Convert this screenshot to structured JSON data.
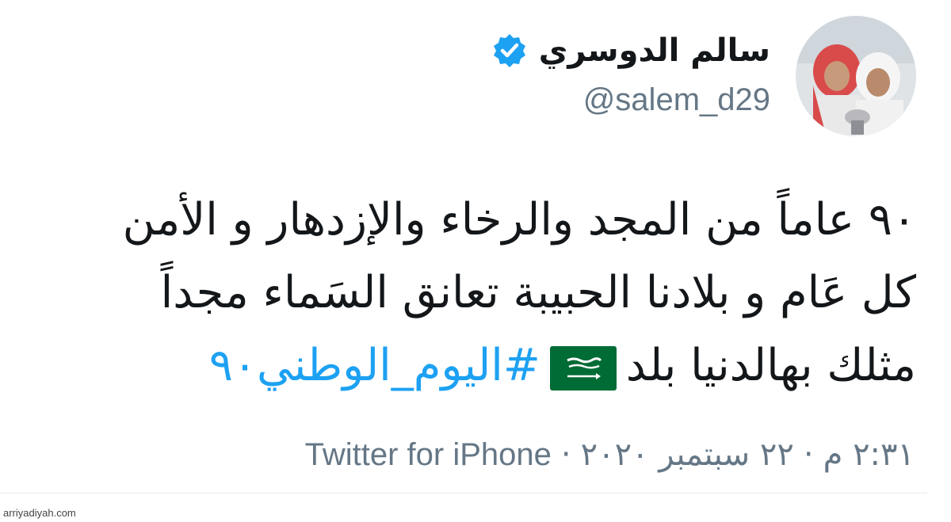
{
  "tweet": {
    "author": {
      "display_name": "سالم الدوسري",
      "handle": "@salem_d29",
      "verified": true,
      "avatar_icon": "profile-photo"
    },
    "lines": [
      "٩٠ عاماً من المجد والرخاء والإزدهار و الأمن",
      "كل عَام و بلادنا الحبيبة تعانق السَماء مجداً"
    ],
    "last_line": {
      "text": "مثلك بهالدنيا بلد",
      "flag_icon": "saudi-flag",
      "hashtag": "#اليوم_الوطني٩٠"
    },
    "meta": {
      "time": "٢:٣١ م",
      "separator": "·",
      "date": "٢٢ سبتمبر ٢٠٢٠",
      "source": "Twitter for iPhone"
    }
  },
  "watermark": "arriyadiyah.com",
  "colors": {
    "text": "#14171a",
    "secondary": "#657786",
    "link": "#1da1f2",
    "verified": "#1da1f2",
    "flag_green": "#006c35"
  }
}
